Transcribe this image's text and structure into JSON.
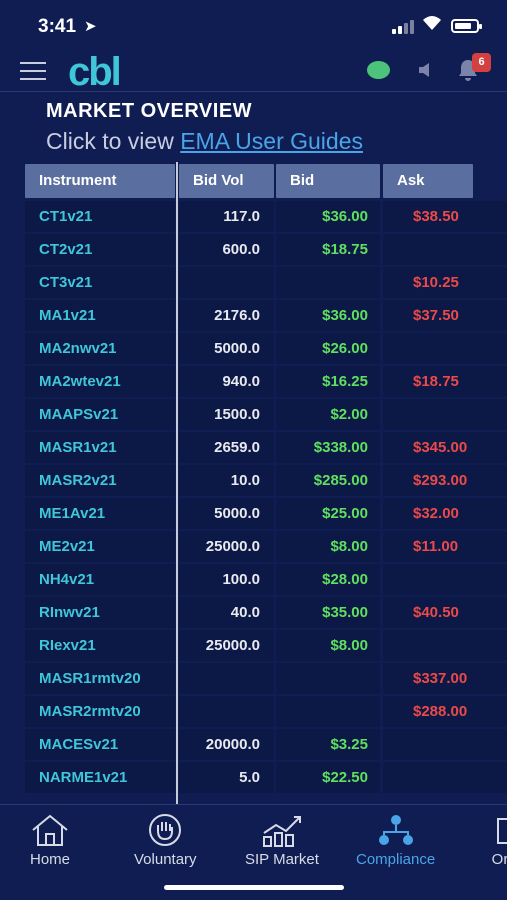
{
  "status_bar": {
    "time": "3:41",
    "location_glyph": "➤"
  },
  "app": {
    "logo": "cbl",
    "notifications_count": "6",
    "connection_color": "#4cc27a"
  },
  "page": {
    "title": "MARKET OVERVIEW",
    "subtitle_prefix": "Click to view ",
    "subtitle_link": "EMA User Guides"
  },
  "table": {
    "headers": [
      "Instrument",
      "Bid Vol",
      "Bid",
      "Ask"
    ],
    "rows": [
      {
        "instrument": "CT1v21",
        "bid_vol": "117.0",
        "bid": "$36.00",
        "ask": "$38.50"
      },
      {
        "instrument": "CT2v21",
        "bid_vol": "600.0",
        "bid": "$18.75",
        "ask": ""
      },
      {
        "instrument": "CT3v21",
        "bid_vol": "",
        "bid": "",
        "ask": "$10.25"
      },
      {
        "instrument": "MA1v21",
        "bid_vol": "2176.0",
        "bid": "$36.00",
        "ask": "$37.50"
      },
      {
        "instrument": "MA2nwv21",
        "bid_vol": "5000.0",
        "bid": "$26.00",
        "ask": ""
      },
      {
        "instrument": "MA2wtev21",
        "bid_vol": "940.0",
        "bid": "$16.25",
        "ask": "$18.75"
      },
      {
        "instrument": "MAAPSv21",
        "bid_vol": "1500.0",
        "bid": "$2.00",
        "ask": ""
      },
      {
        "instrument": "MASR1v21",
        "bid_vol": "2659.0",
        "bid": "$338.00",
        "ask": "$345.00"
      },
      {
        "instrument": "MASR2v21",
        "bid_vol": "10.0",
        "bid": "$285.00",
        "ask": "$293.00"
      },
      {
        "instrument": "ME1Av21",
        "bid_vol": "5000.0",
        "bid": "$25.00",
        "ask": "$32.00"
      },
      {
        "instrument": "ME2v21",
        "bid_vol": "25000.0",
        "bid": "$8.00",
        "ask": "$11.00"
      },
      {
        "instrument": "NH4v21",
        "bid_vol": "100.0",
        "bid": "$28.00",
        "ask": ""
      },
      {
        "instrument": "RInwv21",
        "bid_vol": "40.0",
        "bid": "$35.00",
        "ask": "$40.50"
      },
      {
        "instrument": "RIexv21",
        "bid_vol": "25000.0",
        "bid": "$8.00",
        "ask": ""
      },
      {
        "instrument": "MASR1rmtv20",
        "bid_vol": "",
        "bid": "",
        "ask": "$337.00"
      },
      {
        "instrument": "MASR2rmtv20",
        "bid_vol": "",
        "bid": "",
        "ask": "$288.00"
      },
      {
        "instrument": "MACESv21",
        "bid_vol": "20000.0",
        "bid": "$3.25",
        "ask": ""
      },
      {
        "instrument": "NARME1v21",
        "bid_vol": "5.0",
        "bid": "$22.50",
        "ask": ""
      }
    ]
  },
  "bottom_nav": [
    {
      "label": "Home",
      "icon": "home-icon",
      "active": false
    },
    {
      "label": "Voluntary",
      "icon": "hand-icon",
      "active": false
    },
    {
      "label": "SIP Market",
      "icon": "chart-icon",
      "active": false
    },
    {
      "label": "Compliance",
      "icon": "network-icon",
      "active": true
    },
    {
      "label": "Or",
      "icon": "document-icon",
      "active": false
    }
  ],
  "colors": {
    "background": "#0f1d52",
    "instrument_text": "#3fc6d8",
    "bid_text": "#5fe05f",
    "ask_text": "#ea4a4a",
    "active_nav": "#4aa4e8"
  }
}
